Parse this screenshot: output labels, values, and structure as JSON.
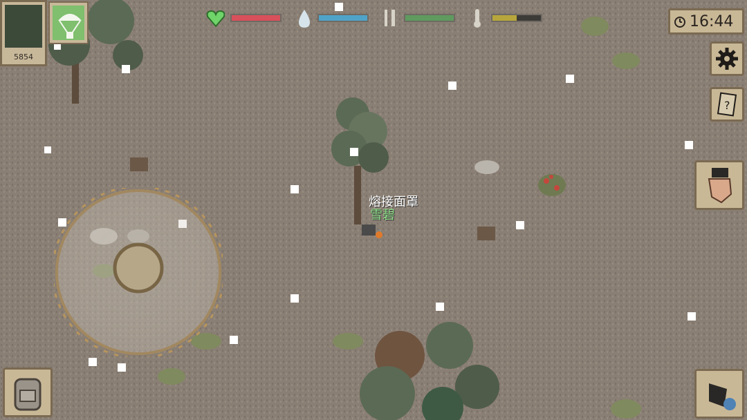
{
  "hud": {
    "score": "5854",
    "clock": "16:44",
    "stats": [
      {
        "name": "health",
        "color": "#d8505a",
        "level": 1.0
      },
      {
        "name": "thirst",
        "color": "#4fa3c9",
        "level": 1.0
      },
      {
        "name": "hunger",
        "color": "#5f9a5f",
        "level": 1.0
      },
      {
        "name": "temperature",
        "color": "#b7a63c",
        "level": 0.5
      }
    ]
  },
  "world": {
    "item_label": "熔接面罩",
    "player_label": "雪碧"
  },
  "colors": {
    "ground": "#8a7f74",
    "tree": "#5b6a55",
    "panel": "#c9b896",
    "panel_border": "#7b6a52"
  },
  "icons": {
    "health": "heart-icon",
    "thirst": "water-drop-icon",
    "hunger": "fork-knife-icon",
    "temperature": "thermometer-icon",
    "settings": "gear-icon",
    "quests": "scroll-icon",
    "interact": "hand-icon",
    "attack": "glove-icon",
    "inventory": "backpack-icon"
  }
}
